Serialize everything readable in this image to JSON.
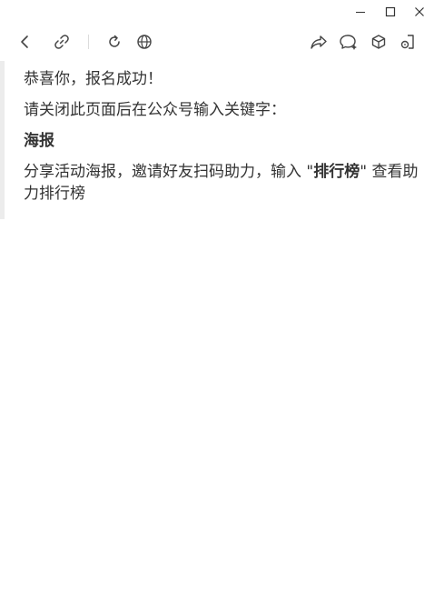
{
  "window": {
    "minimize_icon": "minimize-icon",
    "maximize_icon": "maximize-icon",
    "close_icon": "close-icon"
  },
  "toolbar": {
    "icons": [
      "back-arrow-icon",
      "link-icon",
      "refresh-icon",
      "globe-icon",
      "share-icon",
      "comment-icon",
      "box-icon",
      "mini-program-icon"
    ]
  },
  "message": {
    "line1": "恭喜你，报名成功！",
    "line2": "请关闭此页面后在公众号输入关键字：",
    "keyword": "海报",
    "line3_prefix": "分享活动海报，邀请好友扫码助力，输入 \"",
    "line3_keyword": "排行榜",
    "line3_suffix": "\" 查看助力排行榜"
  }
}
